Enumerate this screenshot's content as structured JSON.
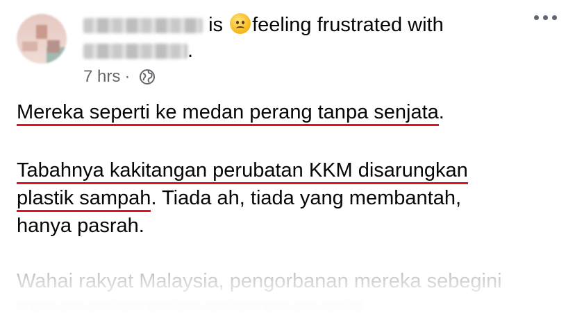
{
  "post": {
    "feeling_prefix": "is",
    "feeling_text": "feeling frustrated with",
    "feeling_icon": "frowning-face-emoji",
    "tagged_suffix": ".",
    "time": "7 hrs",
    "separator": "·",
    "privacy_icon": "globe-icon",
    "more_icon": "more-options-icon",
    "underline_color": "#e0141e",
    "paragraphs": {
      "p1_underlined": "Mereka seperti ke medan perang tanpa senjata",
      "p1_rest": ".",
      "p2_underlined_a": "Tabahnya kakitangan perubatan KKM disarungkan",
      "p2_underlined_b": "plastik sampah",
      "p2_rest": ". Tiada ah, tiada yang membantah,",
      "p2_line3": "hanya pasrah.",
      "p3_line1": "Wahai rakyat Malaysia, pengorbanan mereka sebegini"
    }
  }
}
